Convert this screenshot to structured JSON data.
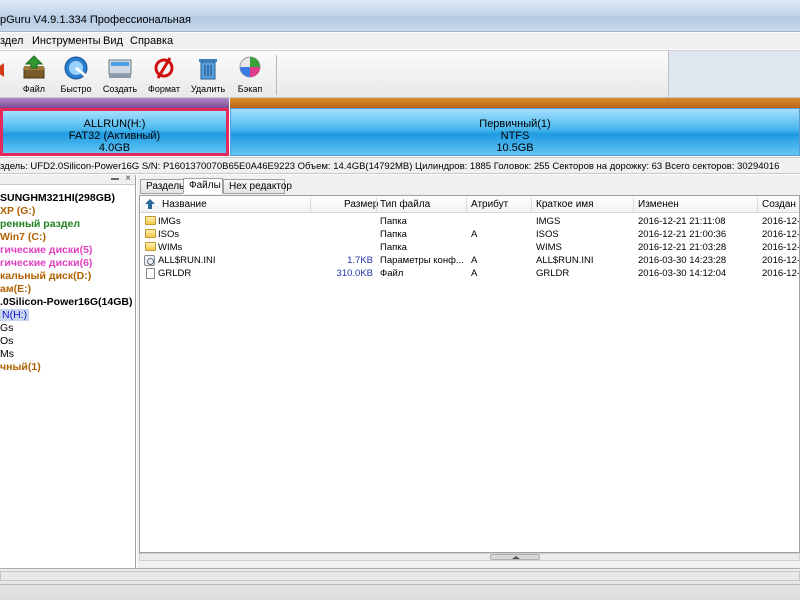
{
  "window": {
    "title": "pGuru V4.9.1.334 Профессиональная"
  },
  "menu": [
    "здел",
    "Инструменты",
    "Вид",
    "Справка"
  ],
  "toolbar": {
    "buttons": [
      {
        "label": "Файл",
        "icon": "file-recovery-icon"
      },
      {
        "label": "Быстро",
        "icon": "quick-partition-icon"
      },
      {
        "label": "Создать",
        "icon": "create-partition-icon"
      },
      {
        "label": "Формат",
        "icon": "format-icon"
      },
      {
        "label": "Удалить",
        "icon": "delete-icon"
      },
      {
        "label": "Бэкап",
        "icon": "backup-icon"
      }
    ]
  },
  "diskmap": {
    "partitions": [
      {
        "name": "ALLRUN(H:)",
        "fs": "FAT32 (Активный)",
        "size": "4.0GB"
      },
      {
        "name": "Первичный(1)",
        "fs": "NTFS",
        "size": "10.5GB"
      }
    ]
  },
  "disk_info": "здель: UFD2.0Silicon-Power16G  S/N: P1601370070B65E0A46E9223  Объем: 14.4GB(14792MB)  Цилиндров: 1885  Головок: 255  Секторов на дорожку: 63  Всего секторов: 30294016",
  "tree": {
    "items": [
      {
        "label": "SUNGHM321HI(298GB)",
        "color": "#000000",
        "bold": true
      },
      {
        "label": "XP (G:)",
        "color": "#b06000",
        "bold": true
      },
      {
        "label": "ренный раздел",
        "color": "#208020",
        "bold": true
      },
      {
        "label": "Win7 (C:)",
        "color": "#b06000",
        "bold": true
      },
      {
        "label": "гические диски(5)",
        "color": "#e040c0",
        "bold": true
      },
      {
        "label": "гические диски(6)",
        "color": "#e040c0",
        "bold": true
      },
      {
        "label": "кальный диск(D:)",
        "color": "#b06000",
        "bold": true
      },
      {
        "label": "ам(E:)",
        "color": "#b06000",
        "bold": true
      },
      {
        "label": ".0Silicon-Power16G(14GB)",
        "color": "#000000",
        "bold": true
      },
      {
        "label": "N(H:)",
        "color": "#1a1acc",
        "bold": false,
        "selected": true
      },
      {
        "label": "Gs",
        "color": "#000000",
        "bold": false
      },
      {
        "label": "Os",
        "color": "#000000",
        "bold": false
      },
      {
        "label": "Ms",
        "color": "#000000",
        "bold": false
      },
      {
        "label": "чный(1)",
        "color": "#b06000",
        "bold": true
      }
    ]
  },
  "tabs": [
    "Разделы",
    "Файлы",
    "Hex редактор"
  ],
  "active_tab": "Файлы",
  "files": {
    "columns": [
      "Название",
      "Размер",
      "Тип файла",
      "Атрибут",
      "Краткое имя",
      "Изменен",
      "Создан"
    ],
    "rows": [
      {
        "name": "IMGs",
        "size": "",
        "type": "Папка",
        "attr": "",
        "short": "IMGS",
        "modified": "2016-12-21 21:11:08",
        "created": "2016-12-",
        "icon": "folder-icon"
      },
      {
        "name": "ISOs",
        "size": "",
        "type": "Папка",
        "attr": "A",
        "short": "ISOS",
        "modified": "2016-12-21 21:00:36",
        "created": "2016-12-",
        "icon": "folder-icon"
      },
      {
        "name": "WIMs",
        "size": "",
        "type": "Папка",
        "attr": "",
        "short": "WIMS",
        "modified": "2016-12-21 21:03:28",
        "created": "2016-12-",
        "icon": "folder-icon"
      },
      {
        "name": "ALL$RUN.INI",
        "size": "1.7KB",
        "type": "Параметры конф...",
        "attr": "A",
        "short": "ALL$RUN.INI",
        "modified": "2016-03-30 14:23:28",
        "created": "2016-12-",
        "icon": "settings-file-icon"
      },
      {
        "name": "GRLDR",
        "size": "310.0KB",
        "type": "Файл",
        "attr": "A",
        "short": "GRLDR",
        "modified": "2016-03-30 14:12:04",
        "created": "2016-12-",
        "icon": "file-icon"
      }
    ]
  }
}
